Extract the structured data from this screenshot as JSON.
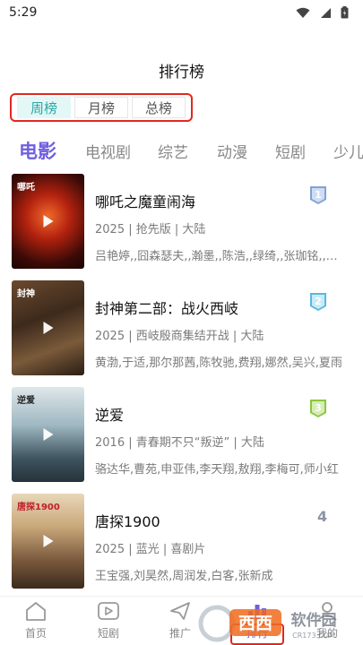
{
  "status_bar": {
    "time": "5:29"
  },
  "header": {
    "title": "排行榜"
  },
  "period_tabs": [
    {
      "label": "周榜",
      "active": true
    },
    {
      "label": "月榜",
      "active": false
    },
    {
      "label": "总榜",
      "active": false
    }
  ],
  "category_tabs": [
    {
      "label": "电影",
      "active": true
    },
    {
      "label": "电视剧",
      "active": false
    },
    {
      "label": "综艺",
      "active": false
    },
    {
      "label": "动漫",
      "active": false
    },
    {
      "label": "短剧",
      "active": false
    },
    {
      "label": "少儿",
      "active": false
    }
  ],
  "movies": [
    {
      "rank": "1",
      "title": "哪吒之魔童闹海",
      "meta": "2025 | 抢先版 | 大陆",
      "cast": "吕艳婷,,囧森瑟夫,,瀚墨,,陈浩,,绿绮,,张珈铭,,杨卫",
      "poster_text": "哪吒",
      "badge_color": "#7fa2d6"
    },
    {
      "rank": "2",
      "title": "封神第二部：战火西岐",
      "meta": "2025 | 西岐殷商集结开战 | 大陆",
      "cast": "黄渤,于适,那尔那茜,陈牧驰,费翔,娜然,吴兴,夏雨",
      "poster_text": "封神",
      "badge_color": "#59b8e3"
    },
    {
      "rank": "3",
      "title": "逆爱",
      "meta": "2016 | 青春期不只“叛逆” | 大陆",
      "cast": "骆达华,曹苑,申亚伟,李天翔,敖翔,李梅可,师小红",
      "poster_text": "逆爱",
      "badge_color": "#8cc63f"
    },
    {
      "rank": "4",
      "title": "唐探1900",
      "meta": "2025 | 蓝光 | 喜剧片",
      "cast": "王宝强,刘昊然,周润发,白客,张新成",
      "poster_text": "唐探1900",
      "badge_color": ""
    }
  ],
  "bottom_nav": [
    {
      "label": "首页",
      "icon": "home-icon",
      "active": false
    },
    {
      "label": "短剧",
      "icon": "play-box-icon",
      "active": false
    },
    {
      "label": "推广",
      "icon": "share-plane-icon",
      "active": false
    },
    {
      "label": "排行",
      "icon": "ranking-icon",
      "active": true
    },
    {
      "label": "我的",
      "icon": "profile-icon",
      "active": false
    }
  ],
  "watermark": {
    "text": "西西软件园",
    "sub": "CR173.COM"
  },
  "colors": {
    "accent": "#6f5fe0",
    "period_active_bg": "#e2f7f6",
    "period_active_text": "#2aa7a5",
    "highlight_border": "#e0281f"
  }
}
